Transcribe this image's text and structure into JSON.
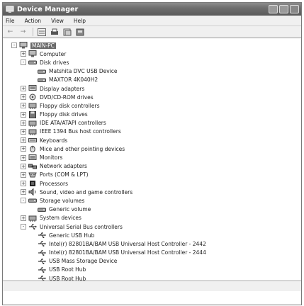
{
  "window": {
    "title": "Device Manager"
  },
  "menu": [
    "File",
    "Action",
    "View",
    "Help"
  ],
  "toolbar_icons": [
    "back-icon",
    "forward-icon",
    "properties-icon",
    "print-icon",
    "help-icon",
    "scan-hardware-icon"
  ],
  "tree": [
    {
      "label": "MAIN-PC",
      "level": 0,
      "exp": "-",
      "icon": "computer",
      "root": true
    },
    {
      "label": "Computer",
      "level": 1,
      "exp": "+",
      "icon": "computer"
    },
    {
      "label": "Disk drives",
      "level": 1,
      "exp": "-",
      "icon": "disk"
    },
    {
      "label": "Matshita DVC USB Device",
      "level": 2,
      "exp": "",
      "icon": "disk"
    },
    {
      "label": "MAXTOR 4K040H2",
      "level": 2,
      "exp": "",
      "icon": "disk"
    },
    {
      "label": "Display adapters",
      "level": 1,
      "exp": "+",
      "icon": "display"
    },
    {
      "label": "DVD/CD-ROM drives",
      "level": 1,
      "exp": "+",
      "icon": "cdrom"
    },
    {
      "label": "Floppy disk controllers",
      "level": 1,
      "exp": "+",
      "icon": "controller"
    },
    {
      "label": "Floppy disk drives",
      "level": 1,
      "exp": "+",
      "icon": "floppy"
    },
    {
      "label": "IDE ATA/ATAPI controllers",
      "level": 1,
      "exp": "+",
      "icon": "controller"
    },
    {
      "label": "IEEE 1394 Bus host controllers",
      "level": 1,
      "exp": "+",
      "icon": "controller"
    },
    {
      "label": "Keyboards",
      "level": 1,
      "exp": "+",
      "icon": "keyboard"
    },
    {
      "label": "Mice and other pointing devices",
      "level": 1,
      "exp": "+",
      "icon": "mouse"
    },
    {
      "label": "Monitors",
      "level": 1,
      "exp": "+",
      "icon": "display"
    },
    {
      "label": "Network adapters",
      "level": 1,
      "exp": "+",
      "icon": "network"
    },
    {
      "label": "Ports (COM & LPT)",
      "level": 1,
      "exp": "+",
      "icon": "port"
    },
    {
      "label": "Processors",
      "level": 1,
      "exp": "+",
      "icon": "processor"
    },
    {
      "label": "Sound, video and game controllers",
      "level": 1,
      "exp": "+",
      "icon": "sound"
    },
    {
      "label": "Storage volumes",
      "level": 1,
      "exp": "-",
      "icon": "disk"
    },
    {
      "label": "Generic volume",
      "level": 2,
      "exp": "",
      "icon": "disk"
    },
    {
      "label": "System devices",
      "level": 1,
      "exp": "+",
      "icon": "controller"
    },
    {
      "label": "Universal Serial Bus controllers",
      "level": 1,
      "exp": "-",
      "icon": "usb"
    },
    {
      "label": "Generic USB Hub",
      "level": 2,
      "exp": "",
      "icon": "usb"
    },
    {
      "label": "Intel(r) 82801BA/BAM USB Universal Host Controller - 2442",
      "level": 2,
      "exp": "",
      "icon": "usb"
    },
    {
      "label": "Intel(r) 82801BA/BAM USB Universal Host Controller - 2444",
      "level": 2,
      "exp": "",
      "icon": "usb"
    },
    {
      "label": "USB Mass Storage Device",
      "level": 2,
      "exp": "",
      "icon": "usb"
    },
    {
      "label": "USB Root Hub",
      "level": 2,
      "exp": "",
      "icon": "usb"
    },
    {
      "label": "USB Root Hub",
      "level": 2,
      "exp": "",
      "icon": "usb"
    }
  ]
}
